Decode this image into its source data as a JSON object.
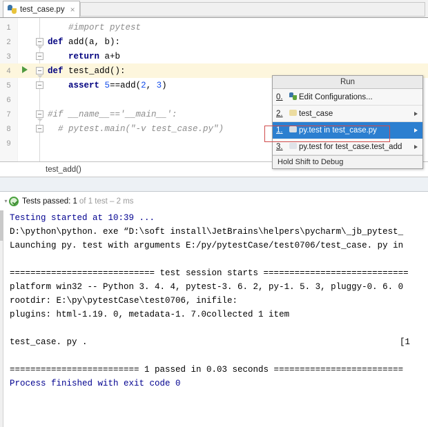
{
  "tab": {
    "file_name": "test_case.py",
    "close_label": "×",
    "icon": "python-file-icon"
  },
  "editor": {
    "lines": [
      {
        "n": "1",
        "fold": "none",
        "run": false,
        "highlight": false,
        "tokens": [
          {
            "t": "comment",
            "s": "    #import pytest"
          }
        ]
      },
      {
        "n": "2",
        "fold": "open-v",
        "run": false,
        "highlight": false,
        "tokens": [
          {
            "t": "kw",
            "s": "def"
          },
          {
            "t": "plain",
            "s": " add(a, b):"
          }
        ]
      },
      {
        "n": "3",
        "fold": "open",
        "run": false,
        "highlight": false,
        "tokens": [
          {
            "t": "plain",
            "s": "    "
          },
          {
            "t": "kw",
            "s": "return"
          },
          {
            "t": "plain",
            "s": " a+b"
          }
        ]
      },
      {
        "n": "4",
        "fold": "open-v",
        "run": true,
        "highlight": true,
        "tokens": [
          {
            "t": "kw",
            "s": "def"
          },
          {
            "t": "plain",
            "s": " test_add():"
          }
        ]
      },
      {
        "n": "5",
        "fold": "open",
        "run": false,
        "highlight": false,
        "tokens": [
          {
            "t": "plain",
            "s": "    "
          },
          {
            "t": "kw",
            "s": "assert"
          },
          {
            "t": "plain",
            "s": " "
          },
          {
            "t": "num",
            "s": "5"
          },
          {
            "t": "plain",
            "s": "==add("
          },
          {
            "t": "num",
            "s": "2"
          },
          {
            "t": "plain",
            "s": ", "
          },
          {
            "t": "num",
            "s": "3"
          },
          {
            "t": "plain",
            "s": ")"
          }
        ]
      },
      {
        "n": "6",
        "fold": "none",
        "run": false,
        "highlight": false,
        "tokens": []
      },
      {
        "n": "7",
        "fold": "open-v",
        "run": false,
        "highlight": false,
        "tokens": [
          {
            "t": "comment",
            "s": "#if __name__=='__main__':"
          }
        ]
      },
      {
        "n": "8",
        "fold": "open",
        "run": false,
        "highlight": false,
        "tokens": [
          {
            "t": "comment",
            "s": "  # pytest.main(\"-v test_case.py\")"
          }
        ]
      },
      {
        "n": "9",
        "fold": "none",
        "run": false,
        "highlight": false,
        "tokens": []
      }
    ],
    "breadcrumb": "test_add()"
  },
  "run_menu": {
    "title": "Run",
    "items": [
      {
        "num": "0.",
        "icon": "run-config-icon",
        "label": "Edit Configurations...",
        "submenu": false,
        "selected": false
      },
      {
        "num": "2.",
        "icon": "python-run-icon",
        "label": "test_case",
        "submenu": true,
        "selected": false
      },
      {
        "num": "1.",
        "icon": "pytest-run-icon",
        "label": "py.test in test_case.py",
        "submenu": true,
        "selected": true
      },
      {
        "num": "3.",
        "icon": "pytest-run-icon",
        "label": "py.test for test_case.test_add",
        "submenu": true,
        "selected": false
      }
    ],
    "hint": "Hold Shift to Debug"
  },
  "test_status": {
    "caret": "▾",
    "icon": "green-check-icon",
    "main": "Tests passed: 1",
    "dim": "of 1 test – 2 ms"
  },
  "console": {
    "lines": [
      {
        "text": "Testing started at 10:39 ...",
        "color": "blue"
      },
      {
        "text": "D:\\python\\python. exe “D:\\soft install\\JetBrains\\helpers\\pycharm\\_jb_pytest_",
        "color": "black"
      },
      {
        "text": "Launching py. test with arguments E:/py/pytestCase/test0706/test_case. py in",
        "color": "black"
      },
      {
        "text": "",
        "color": "black"
      },
      {
        "text": "============================ test session starts ============================",
        "color": "black"
      },
      {
        "text": "platform win32 -- Python 3. 4. 4, pytest-3. 6. 2, py-1. 5. 3, pluggy-0. 6. 0",
        "color": "black"
      },
      {
        "text": "rootdir: E:\\py\\pytestCase\\test0706, inifile:",
        "color": "black"
      },
      {
        "text": "plugins: html-1.19. 0, metadata-1. 7.0collected 1 item",
        "color": "black"
      },
      {
        "text": "",
        "color": "black"
      },
      {
        "text": "test_case. py .",
        "color": "black",
        "right": "[1"
      },
      {
        "text": "",
        "color": "black"
      },
      {
        "text": "========================= 1 passed in 0.03 seconds =========================",
        "color": "black"
      },
      {
        "text": "Process finished with exit code 0",
        "color": "blue"
      }
    ]
  },
  "colors": {
    "accent_selection": "#2c7fd0",
    "highlight_line": "#fdf6dd",
    "pass_green": "#4aa13e",
    "annotation_red": "#d04a4a",
    "keyword_blue": "#00007f",
    "number_blue": "#1750eb",
    "comment_gray": "#8c8c8c"
  }
}
